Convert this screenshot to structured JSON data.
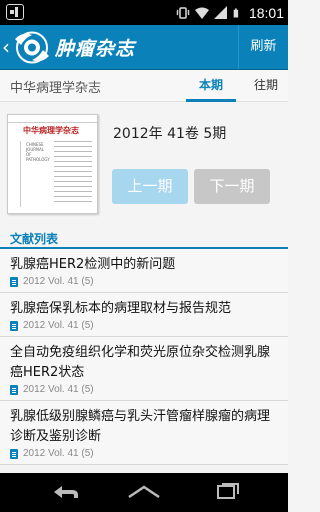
{
  "status_bar": {
    "time": "18:01"
  },
  "app": {
    "title": "肿瘤杂志",
    "refresh_label": "刷新"
  },
  "journal": {
    "name": "中华病理学杂志",
    "tabs": [
      {
        "label": "本期"
      },
      {
        "label": "往期"
      }
    ]
  },
  "issue": {
    "label": "2012年 41卷 5期",
    "cover": {
      "title_cn": "中华病理学杂志",
      "title_en": [
        "CHINESE",
        "JOURNAL",
        "OF",
        "PATHOLOGY"
      ]
    },
    "prev_label": "上一期",
    "next_label": "下一期"
  },
  "list": {
    "header": "文献列表",
    "articles": [
      {
        "title": "乳腺癌HER2检测中的新问题",
        "meta": "2012 Vol. 41 (5)"
      },
      {
        "title": "乳腺癌保乳标本的病理取材与报告规范",
        "meta": "2012 Vol. 41 (5)"
      },
      {
        "title": "全自动免疫组织化学和荧光原位杂交检测乳腺癌HER2状态",
        "meta": "2012 Vol. 41 (5)"
      },
      {
        "title": "乳腺低级别腺鳞癌与乳头汗管瘤样腺瘤的病理诊断及鉴别诊断",
        "meta": "2012 Vol. 41 (5)"
      }
    ]
  },
  "colors": {
    "accent": "#0a81b8",
    "prev_button": "#a7d6ef",
    "next_button": "#c7c7c7"
  }
}
